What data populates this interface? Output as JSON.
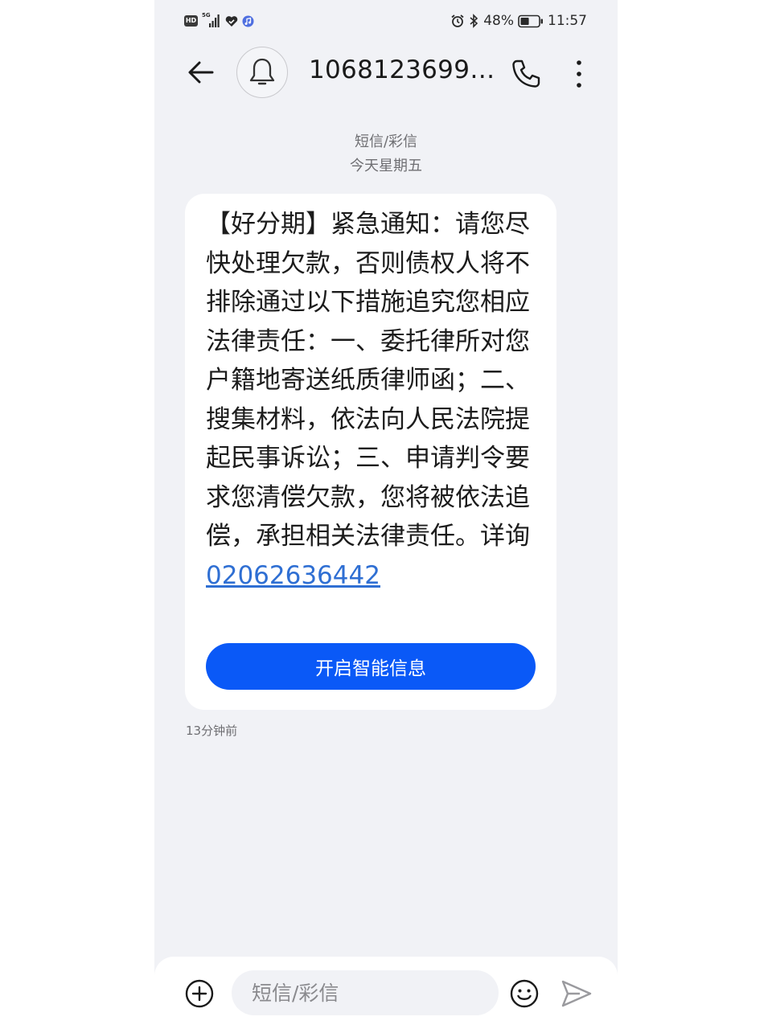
{
  "status_bar": {
    "network_badge": "HD",
    "network_type": "5G",
    "battery_percent": "48%",
    "battery_level": 0.48,
    "time": "11:57"
  },
  "header": {
    "contact": "10681236998...",
    "icons": [
      "back-arrow-icon",
      "bell-icon",
      "phone-icon",
      "more-vertical-icon"
    ]
  },
  "thread": {
    "message_type": "短信/彩信",
    "date": "今天星期五",
    "message": {
      "body": "【好分期】紧急通知：请您尽快处理欠款，否则债权人将不排除通过以下措施追究您相应法律责任：一、委托律所对您户籍地寄送纸质律师函；二、搜集材料，依法向人民法院提起民事诉讼；三、申请判令要求您清偿欠款，您将被依法追偿，承担相关法律责任。详询",
      "link": "02062636442",
      "action_button": "开启智能信息",
      "time_ago": "13分钟前"
    }
  },
  "composer": {
    "placeholder": "短信/彩信",
    "icons": [
      "add-circle-icon",
      "emoji-icon",
      "send-icon"
    ]
  },
  "colors": {
    "accent": "#0a59f7",
    "link": "#2f6fd3",
    "background": "#f1f2f6"
  }
}
